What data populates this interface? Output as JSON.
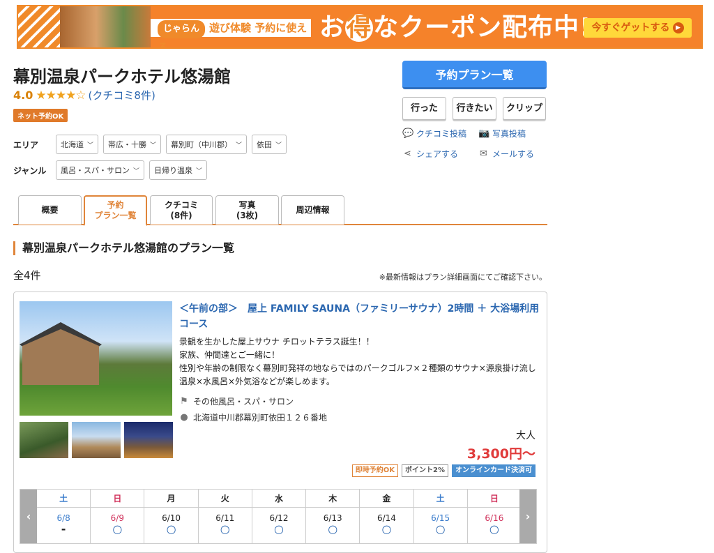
{
  "banner": {
    "ribbon_pill": "じゃらん",
    "ribbon_text": "遊び体験 予約に使える",
    "headline_a": "お",
    "headline_circle": "得",
    "headline_b": "なクーポン配布中!",
    "cta": "今すぐゲットする"
  },
  "facility": {
    "name": "幕別温泉パークホテル悠湯館",
    "score": "4.0",
    "stars": "★★★★☆",
    "review_link": "(クチコミ8件)",
    "badge": "ネット予約OK"
  },
  "filters": {
    "area_label": "エリア",
    "area": [
      "北海道",
      "帯広・十勝",
      "幕別町（中川郡）",
      "依田"
    ],
    "genre_label": "ジャンル",
    "genre": [
      "風呂・スパ・サロン",
      "日帰り温泉"
    ]
  },
  "side": {
    "plan_button": "予約プラン一覧",
    "went": "行った",
    "want": "行きたい",
    "clip": "クリップ",
    "review_post": "クチコミ投稿",
    "photo_post": "写真投稿",
    "share": "シェアする",
    "mail": "メールする"
  },
  "tabs": [
    {
      "l1": "概要",
      "l2": ""
    },
    {
      "l1": "予約",
      "l2": "プラン一覧"
    },
    {
      "l1": "クチコミ",
      "l2": "(8件)"
    },
    {
      "l1": "写真",
      "l2": "(3枚)"
    },
    {
      "l1": "周辺情報",
      "l2": ""
    }
  ],
  "list": {
    "section_title": "幕別温泉パークホテル悠湯館のプラン一覧",
    "count": "全4件",
    "note": "※最新情報はプラン詳細画面にてご確認下さい。"
  },
  "plan": {
    "title": "＜午前の部＞　屋上 FAMILY SAUNA（ファミリーサウナ）2時間 ＋ 大浴場利用コース",
    "desc": [
      "景観を生かした屋上サウナ チロットテラス誕生！！",
      "家族、仲間達とご一緒に！",
      "性別や年齢の制限なく幕別町発祥の地ならではのパークゴルフ×２種類のサウナ×源泉掛け流し温泉×水風呂×外気浴などが楽しめます。"
    ],
    "category": "その他風呂・スパ・サロン",
    "address": "北海道中川郡幕別町依田１２６番地",
    "adult_label": "大人",
    "price": "3,300円〜",
    "badge_instant": "即時予約OK",
    "badge_point": "ポイント2%",
    "badge_card": "オンラインカード決済可"
  },
  "calendar": {
    "prev": "‹",
    "next": "›",
    "days": [
      {
        "dow": "土",
        "date": "6/8",
        "avail": "-",
        "type": "sat"
      },
      {
        "dow": "日",
        "date": "6/9",
        "avail": "○",
        "type": "sun"
      },
      {
        "dow": "月",
        "date": "6/10",
        "avail": "○",
        "type": ""
      },
      {
        "dow": "火",
        "date": "6/11",
        "avail": "○",
        "type": ""
      },
      {
        "dow": "水",
        "date": "6/12",
        "avail": "○",
        "type": ""
      },
      {
        "dow": "木",
        "date": "6/13",
        "avail": "○",
        "type": ""
      },
      {
        "dow": "金",
        "date": "6/14",
        "avail": "○",
        "type": ""
      },
      {
        "dow": "土",
        "date": "6/15",
        "avail": "○",
        "type": "sat"
      },
      {
        "dow": "日",
        "date": "6/16",
        "avail": "○",
        "type": "sun"
      }
    ]
  }
}
